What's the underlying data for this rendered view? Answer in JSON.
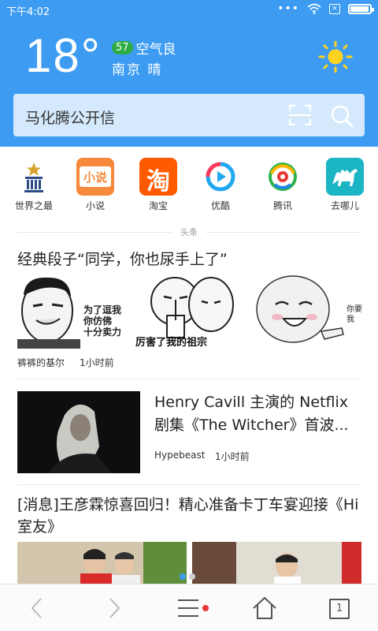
{
  "statusbar": {
    "time": "下午4:02",
    "battery_level": 0.95
  },
  "weather": {
    "temperature": "18°",
    "aqi_value": "57",
    "aqi_label": "空气良",
    "location_condition": "南京  晴",
    "icon": "sun-icon"
  },
  "search": {
    "value": "马化腾公开信",
    "scan_icon": "scan-icon",
    "search_icon": "search-icon"
  },
  "quick_links": [
    {
      "label": "世界之最"
    },
    {
      "label": "小说",
      "icon_text": "小说"
    },
    {
      "label": "淘宝",
      "icon_text": "淘"
    },
    {
      "label": "优酷"
    },
    {
      "label": "腾讯"
    },
    {
      "label": "去哪儿"
    }
  ],
  "feed": {
    "section_label": "头条",
    "articles": [
      {
        "title": "经典段子“同学，你也尿手上了”",
        "meme_texts": [
          "为了逗我\n你仿佛\n十分卖力",
          "厉害了我的祖宗",
          "你要\n我"
        ],
        "source": "裤裤的基尔",
        "time": "1小时前"
      },
      {
        "title": "Henry Cavill 主演的 Netflix 剧集《The Witcher》首波...",
        "source": "Hypebeast",
        "time": "1小时前"
      },
      {
        "title": "[消息]王彦霖惊喜回归！精心准备卡丁车宴迎接《Hi室友》"
      }
    ]
  },
  "bottombar": {
    "tabs_count": "1"
  },
  "colors": {
    "header_bg": "#3d9cf2",
    "aqi_badge": "#2dab43",
    "menu_dot": "#e8343b"
  }
}
